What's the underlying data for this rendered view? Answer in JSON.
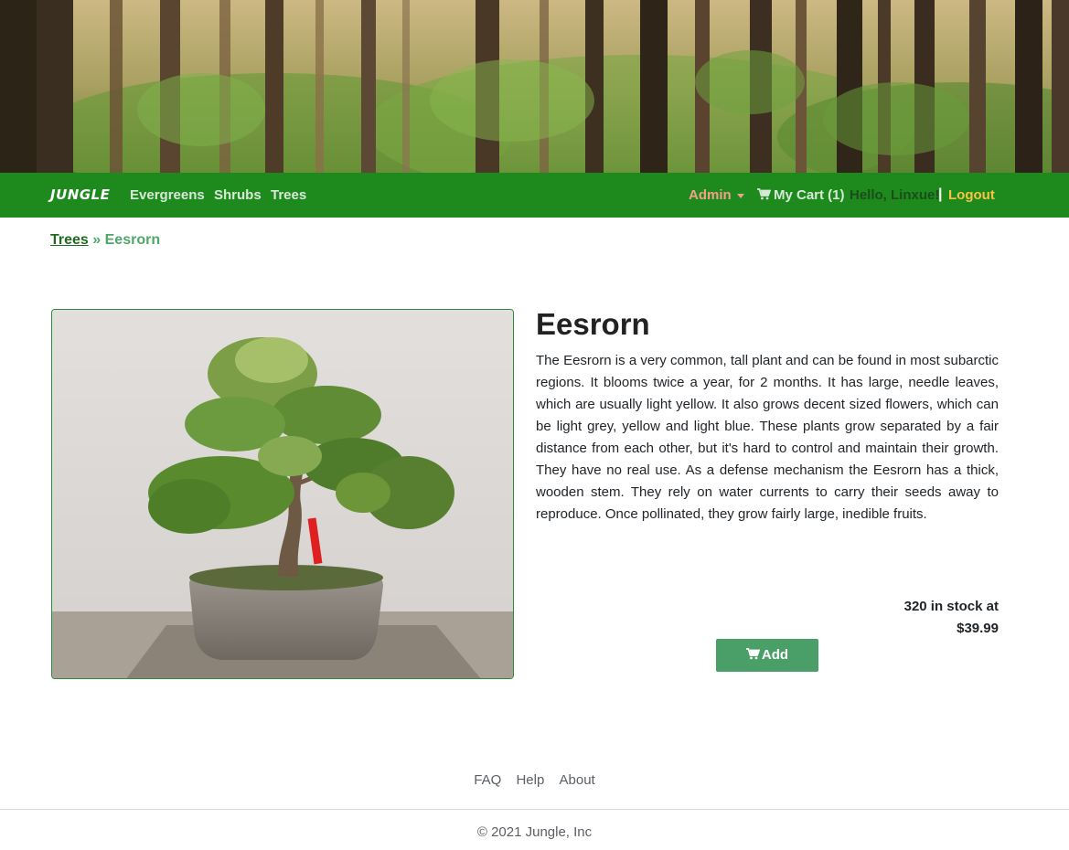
{
  "nav": {
    "brand": "JUNGLE",
    "links": [
      "Evergreens",
      "Shrubs",
      "Trees"
    ],
    "admin": "Admin",
    "cart_label": "My Cart (1)",
    "greeting": "Hello, Linxue!",
    "separator": "|",
    "logout": "Logout"
  },
  "breadcrumb": {
    "parent": "Trees",
    "separator": "»",
    "current": "Eesrorn"
  },
  "product": {
    "name": "Eesrorn",
    "description": "The Eesrorn is a very common, tall plant and can be found in most subarctic regions. It blooms twice a year, for 2 months. It has large, needle leaves, which are usually light yellow. It also grows decent sized flowers, which can be light grey, yellow and light blue. These plants grow separated by a fair distance from each other, but it's hard to control and maintain their growth. They have no real use. As a defense mechanism the Eesrorn has a thick, wooden stem. They rely on water currents to carry their seeds away to reproduce. Once pollinated, they grow fairly large, inedible fruits.",
    "stock_text": "320 in stock at",
    "price": "$39.99",
    "add_label": "Add"
  },
  "footer": {
    "links": [
      "FAQ",
      "Help",
      "About"
    ],
    "copyright": "© 2021 Jungle, Inc"
  },
  "colors": {
    "navbar": "#1e8a1e",
    "accent_green": "#4a9e68",
    "admin": "#f2a08a",
    "logout": "#f5c542"
  }
}
